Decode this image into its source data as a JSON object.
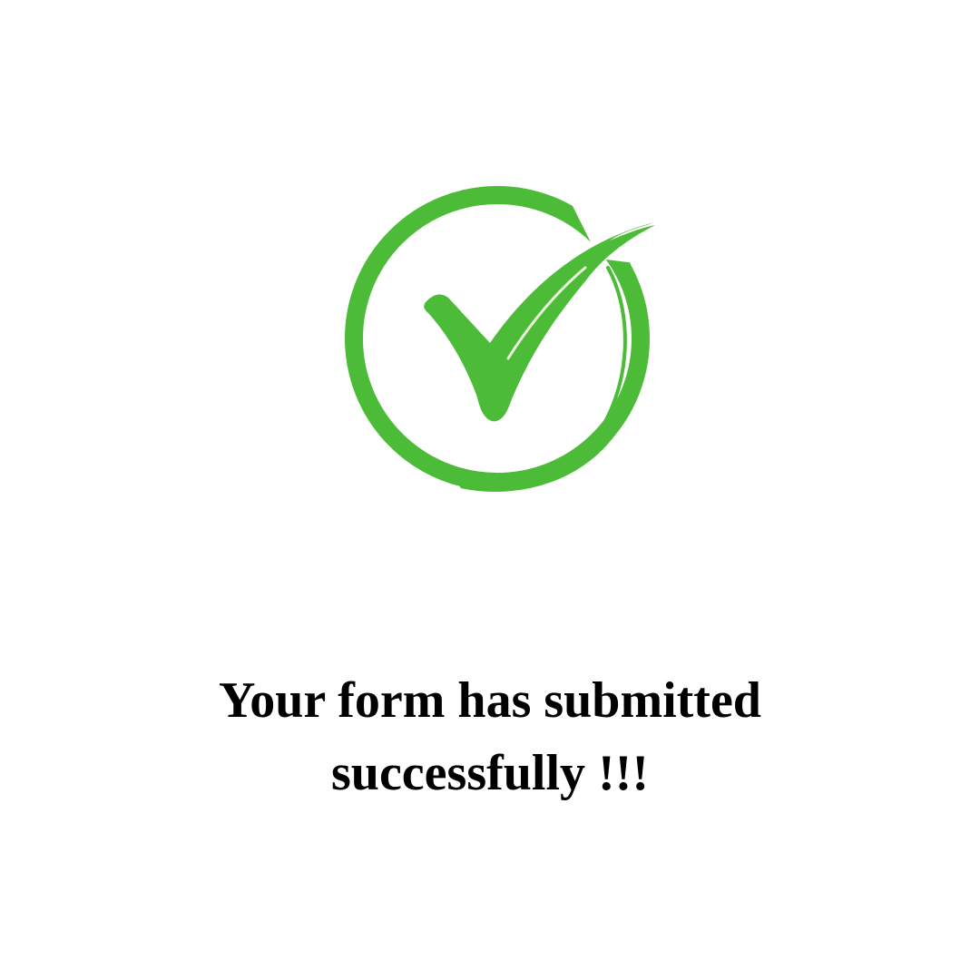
{
  "success_icon": {
    "name": "check-circle-icon",
    "color": "#4cbb37"
  },
  "message": {
    "line1": "Your form has submitted",
    "line2": "successfully !!!"
  }
}
